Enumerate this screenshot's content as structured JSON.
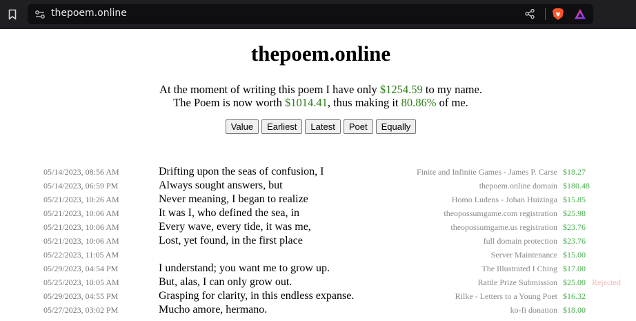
{
  "browser": {
    "url": "thepoem.online"
  },
  "page": {
    "title": "thepoem.online",
    "summary": {
      "line1_pre": "At the moment of writing this poem I have only ",
      "balance": "$1254.59",
      "line1_post": " to my name.",
      "line2_pre": "The Poem is now worth ",
      "worth": "$1014.41",
      "line2_mid": ", thus making it ",
      "percent": "80.86%",
      "line2_post": " of me."
    },
    "sort_buttons": [
      "Value",
      "Earliest",
      "Latest",
      "Poet",
      "Equally"
    ],
    "rows": [
      {
        "date": "05/14/2023, 08:56 AM",
        "line": "Drifting upon the seas of confusion, I",
        "desc": "Finite and Infinite Games - James P. Carse",
        "amount": "$18.27",
        "status": ""
      },
      {
        "date": "05/14/2023, 06:59 PM",
        "line": "Always sought answers, but",
        "desc": "thepoem.online domain",
        "amount": "$180.48",
        "status": ""
      },
      {
        "date": "05/21/2023, 10:26 AM",
        "line": "Never meaning, I began to realize",
        "desc": "Homo Ludens - Johan Huizinga",
        "amount": "$15.85",
        "status": ""
      },
      {
        "date": "05/21/2023, 10:06 AM",
        "line": "It was I, who defined the sea, in",
        "desc": "theopossumgame.com registration",
        "amount": "$25.98",
        "status": ""
      },
      {
        "date": "05/21/2023, 10:06 AM",
        "line": "Every wave, every tide, it was me,",
        "desc": "theopossumgame.us registration",
        "amount": "$23.76",
        "status": ""
      },
      {
        "date": "05/21/2023, 10:06 AM",
        "line": "Lost, yet found, in the first place",
        "desc": "full domain protection",
        "amount": "$23.76",
        "status": ""
      },
      {
        "date": "05/22/2023, 11:05 AM",
        "line": "",
        "desc": "Server Maintenance",
        "amount": "$15.00",
        "status": ""
      },
      {
        "date": "05/29/2023, 04:54 PM",
        "line": "I understand; you want me to grow up.",
        "desc": "The Illustrated I Ching",
        "amount": "$17.00",
        "status": ""
      },
      {
        "date": "05/25/2023, 10:05 AM",
        "line": "But, alas, I can only grow out.",
        "desc": "Rattle Prize Submission",
        "amount": "$25.00",
        "status": "Rejected"
      },
      {
        "date": "05/29/2023, 04:55 PM",
        "line": "Grasping for clarity, in this endless expanse.",
        "desc": "Rilke - Letters to a Young Poet",
        "amount": "$16.32",
        "status": ""
      },
      {
        "date": "05/27/2023, 03:02 PM",
        "line": "Mucho amore, hermano.",
        "desc": "ko-fi donation",
        "amount": "$18.00",
        "status": ""
      }
    ]
  },
  "colors": {
    "money": "#2f7d1a",
    "amount": "#4caf50",
    "rejected": "#f4b4b4",
    "chrome": "#1f1f23"
  },
  "icons": [
    "bookmark-icon",
    "site-settings-icon",
    "share-icon",
    "brave-shields-icon",
    "brave-rewards-icon"
  ]
}
